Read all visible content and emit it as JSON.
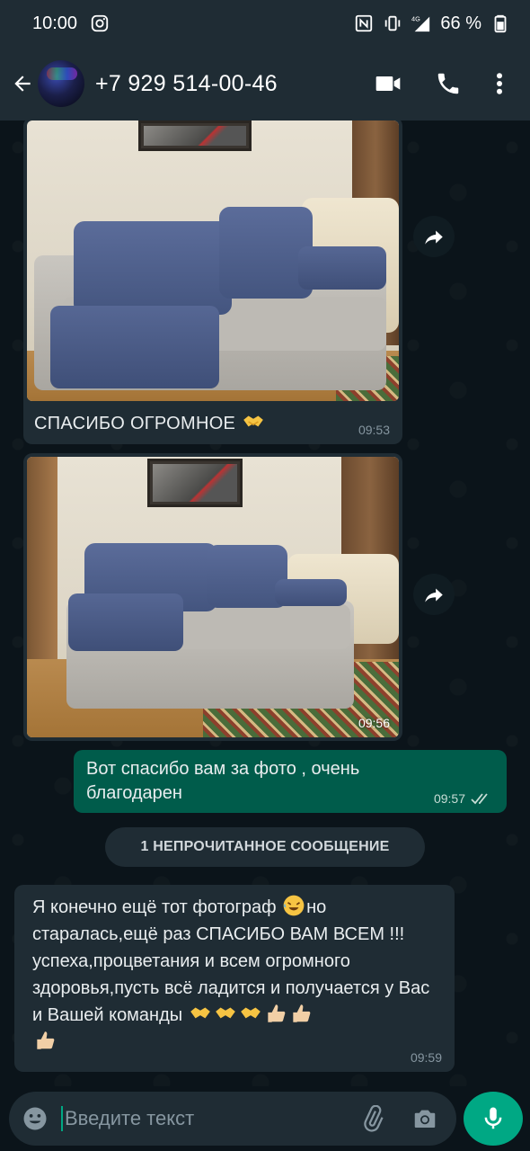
{
  "status_bar": {
    "time": "10:00",
    "battery": "66 %",
    "network": "4G"
  },
  "header": {
    "contact": "+7 929 514-00-46"
  },
  "messages": [
    {
      "caption": "СПАСИБО ОГРОМНОЕ",
      "time": "09:53"
    },
    {
      "time": "09:56"
    },
    {
      "text": "Вот спасибо вам за фото , очень благодарен",
      "time": "09:57"
    },
    {
      "text_line1": "Я конечно ещё тот фотограф",
      "text_line1b": "но",
      "text_rest": "старалась,ещё раз СПАСИБО ВАМ ВСЕМ !!! успеха,процветания и всем огромного здоровья,пусть всё ладится и получается у Вас и Вашей команды",
      "time": "09:59"
    }
  ],
  "unread_banner": "1 НЕПРОЧИТАННОЕ СООБЩЕНИЕ",
  "composer": {
    "placeholder": "Введите текст"
  },
  "colors": {
    "accent": "#00a884",
    "outgoing_bubble": "#005c4b",
    "incoming_bubble": "#1f2c34"
  }
}
